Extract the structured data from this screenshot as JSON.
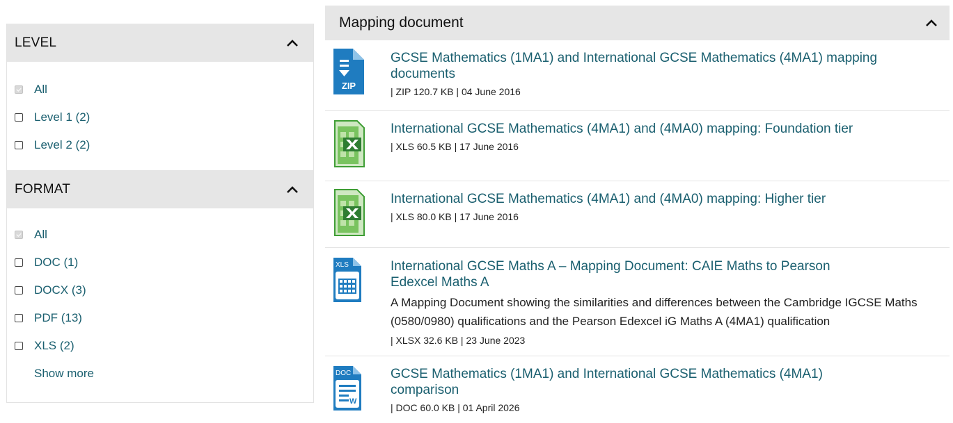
{
  "level_facet": {
    "title": "LEVEL",
    "items": [
      {
        "label": "All",
        "checked": true
      },
      {
        "label": "Level 1 (2)",
        "checked": false
      },
      {
        "label": "Level 2 (2)",
        "checked": false
      }
    ]
  },
  "format_facet": {
    "title": "FORMAT",
    "items": [
      {
        "label": "All",
        "checked": true
      },
      {
        "label": "DOC (1)",
        "checked": false
      },
      {
        "label": "DOCX (3)",
        "checked": false
      },
      {
        "label": "PDF (13)",
        "checked": false
      },
      {
        "label": "XLS (2)",
        "checked": false
      }
    ],
    "show_more": "Show more"
  },
  "main": {
    "title": "Mapping document",
    "documents": [
      {
        "icon": "zip-file-icon",
        "title": "GCSE Mathematics (1MA1) and International GCSE Mathematics (4MA1) mapping documents",
        "description": "",
        "meta": "| ZIP 120.7 KB | 04 June 2016"
      },
      {
        "icon": "excel-file-icon",
        "title": "International GCSE Mathematics (4MA1) and (4MA0) mapping: Foundation tier",
        "description": "",
        "meta": "| XLS 60.5 KB | 17 June 2016"
      },
      {
        "icon": "excel-file-icon",
        "title": "International GCSE Mathematics (4MA1) and (4MA0) mapping: Higher tier",
        "description": "",
        "meta": "| XLS 80.0 KB | 17 June 2016"
      },
      {
        "icon": "xls-file-icon",
        "title": "International GCSE Maths A – Mapping Document: CAIE Maths to Pearson Edexcel Maths A",
        "description": "A Mapping Document showing the similarities and differences between the Cambridge IGCSE Maths (0580/0980) qualifications and the Pearson Edexcel iG Maths A (4MA1) qualification",
        "meta": "| XLSX 32.6 KB | 23 June 2023"
      },
      {
        "icon": "doc-file-icon",
        "title": "GCSE Mathematics (1MA1) and International GCSE Mathematics (4MA1) comparison",
        "description": "",
        "meta": "| DOC 60.0 KB | 01 April 2026"
      }
    ]
  },
  "icon_labels": {
    "zip": "ZIP",
    "xls": "XLS",
    "doc": "DOC",
    "w": "W"
  },
  "colors": {
    "link": "#1a5f6f",
    "header_bg": "#e6e6e6",
    "file_icon_blue": "#1f7cc0",
    "excel_green": "#3f9e35"
  }
}
